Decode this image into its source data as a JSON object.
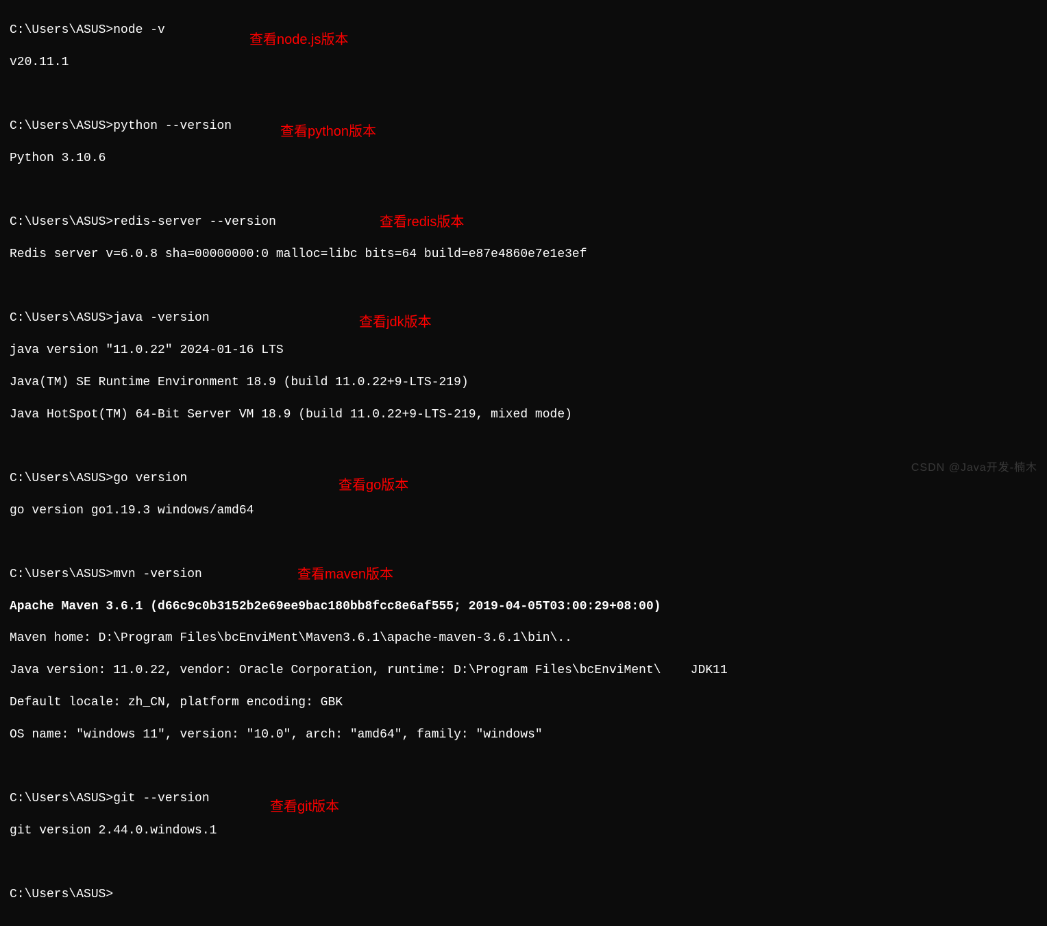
{
  "prompt": "C:\\Users\\ASUS>",
  "commands": {
    "node": {
      "cmd": "node -v",
      "out": "v20.11.1",
      "annotation": "查看node.js版本"
    },
    "python": {
      "cmd": "python --version",
      "out": "Python 3.10.6",
      "annotation": "查看python版本"
    },
    "redis": {
      "cmd": "redis-server --version",
      "out": "Redis server v=6.0.8 sha=00000000:0 malloc=libc bits=64 build=e87e4860e7e1e3ef",
      "annotation": "查看redis版本"
    },
    "java": {
      "cmd": "java -version",
      "out1": "java version \"11.0.22\" 2024-01-16 LTS",
      "out2": "Java(TM) SE Runtime Environment 18.9 (build 11.0.22+9-LTS-219)",
      "out3": "Java HotSpot(TM) 64-Bit Server VM 18.9 (build 11.0.22+9-LTS-219, mixed mode)",
      "annotation": "查看jdk版本"
    },
    "go": {
      "cmd": "go version",
      "out": "go version go1.19.3 windows/amd64",
      "annotation": "查看go版本"
    },
    "mvn": {
      "cmd": "mvn -version",
      "out1": "Apache Maven 3.6.1 (d66c9c0b3152b2e69ee9bac180bb8fcc8e6af555; 2019-04-05T03:00:29+08:00)",
      "out2": "Maven home: D:\\Program Files\\bcEnviMent\\Maven3.6.1\\apache-maven-3.6.1\\bin\\..",
      "out3": "Java version: 11.0.22, vendor: Oracle Corporation, runtime: D:\\Program Files\\bcEnviMent\\    JDK11",
      "out4": "Default locale: zh_CN, platform encoding: GBK",
      "out5": "OS name: \"windows 11\", version: \"10.0\", arch: \"amd64\", family: \"windows\"",
      "annotation": "查看maven版本"
    },
    "git": {
      "cmd": "git --version",
      "out": "git version 2.44.0.windows.1",
      "annotation": "查看git版本"
    }
  },
  "watermark": "CSDN @Java开发-楠木"
}
